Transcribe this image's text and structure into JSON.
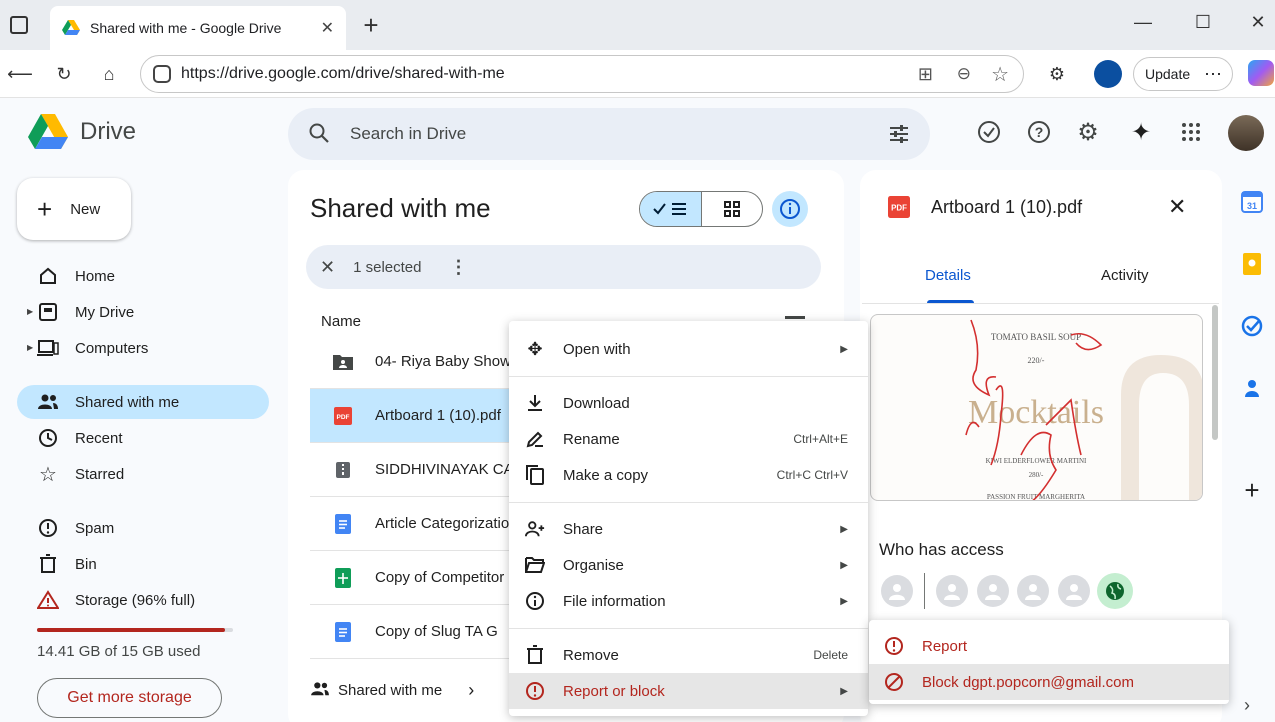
{
  "browser": {
    "tab_title": "Shared with me - Google Drive",
    "url": "https://drive.google.com/drive/shared-with-me",
    "update_label": "Update"
  },
  "app": {
    "name": "Drive",
    "search_placeholder": "Search in Drive"
  },
  "sidebar": {
    "new_label": "New",
    "items": [
      {
        "label": "Home",
        "icon": "home-icon"
      },
      {
        "label": "My Drive",
        "icon": "my-drive-icon"
      },
      {
        "label": "Computers",
        "icon": "computers-icon"
      },
      {
        "label": "Shared with me",
        "icon": "shared-icon"
      },
      {
        "label": "Recent",
        "icon": "clock-icon"
      },
      {
        "label": "Starred",
        "icon": "star-icon"
      },
      {
        "label": "Spam",
        "icon": "spam-icon"
      },
      {
        "label": "Bin",
        "icon": "bin-icon"
      },
      {
        "label": "Storage (96% full)",
        "icon": "cloud-warning-icon"
      }
    ],
    "storage_percent": 96,
    "storage_used": "14.41 GB of 15 GB used",
    "get_storage_label": "Get more storage"
  },
  "main": {
    "title": "Shared with me",
    "selected_text": "1 selected",
    "column_name": "Name",
    "files": [
      {
        "name": "04- Riya Baby Shower",
        "type": "shared-folder"
      },
      {
        "name": "Artboard 1 (10).pdf",
        "type": "pdf"
      },
      {
        "name": "SIDDHIVINAYAK CA",
        "type": "zip"
      },
      {
        "name": "Article Categorization",
        "type": "doc"
      },
      {
        "name": "Copy of Competitor",
        "type": "sheet"
      },
      {
        "name": "Copy of Slug TA G",
        "type": "doc"
      }
    ],
    "bottom_nav": "Shared with me"
  },
  "context_menu": {
    "items": [
      {
        "label": "Open with",
        "shortcut": "",
        "submenu": true
      },
      {
        "label": "Download",
        "shortcut": "",
        "submenu": false
      },
      {
        "label": "Rename",
        "shortcut": "Ctrl+Alt+E",
        "submenu": false
      },
      {
        "label": "Make a copy",
        "shortcut": "Ctrl+C Ctrl+V",
        "submenu": false
      },
      {
        "label": "Share",
        "shortcut": "",
        "submenu": true
      },
      {
        "label": "Organise",
        "shortcut": "",
        "submenu": true
      },
      {
        "label": "File information",
        "shortcut": "",
        "submenu": true
      },
      {
        "label": "Remove",
        "shortcut": "Delete",
        "submenu": false
      },
      {
        "label": "Report or block",
        "shortcut": "",
        "submenu": true
      }
    ]
  },
  "submenu": {
    "items": [
      {
        "label": "Report"
      },
      {
        "label": "Block dgpt.popcorn@gmail.com"
      }
    ]
  },
  "details": {
    "file_name": "Artboard 1 (10).pdf",
    "tabs": [
      "Details",
      "Activity"
    ],
    "active_tab": "Details",
    "who_has_access": "Who has access",
    "preview": {
      "heading": "TOMATO BASIL SOUP",
      "price1": "220/-",
      "title": "Mocktails",
      "line2": "KIWI ELDERFLOWER MARTINI",
      "price2": "280/-",
      "line3": "PASSION FRUIT MARGHERITA"
    }
  },
  "colors": {
    "accent": "#0b57d0",
    "active_bg": "#c2e7ff",
    "danger": "#b3261e"
  }
}
